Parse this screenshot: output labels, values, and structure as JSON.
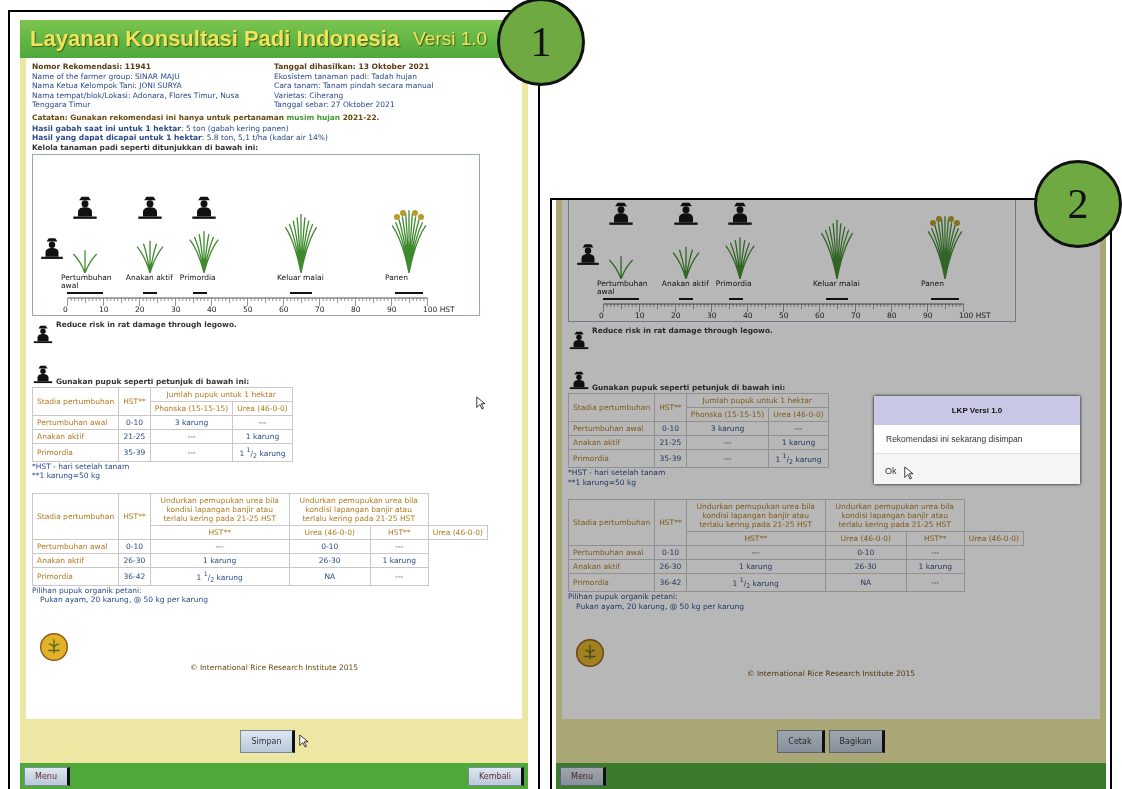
{
  "panels": [
    {
      "badge": "1",
      "header": {
        "title": "Layanan Konsultasi Padi Indonesia",
        "version": "Versi 1.0"
      },
      "info": {
        "left": [
          {
            "kind": "heading",
            "text": "Nomor Rekomendasi: 11941"
          },
          {
            "kind": "line",
            "text": "Name of the farmer group: SINAR MAJU"
          },
          {
            "kind": "line",
            "text": "Nama Ketua Kelompok Tani: JONI SURYA"
          },
          {
            "kind": "small",
            "text": "Nama tempat/blok/Lokasi: Adonara, Flores Timur, Nusa Tenggara Timur"
          }
        ],
        "right": [
          {
            "kind": "heading",
            "text": "Tanggal dihasilkan: 13 Oktober 2021"
          },
          {
            "kind": "line",
            "text": "Ekosistem tanaman padi: Tadah hujan"
          },
          {
            "kind": "line",
            "text": "Cara tanam: Tanam pindah secara manual"
          },
          {
            "kind": "small",
            "text": "Varietas: Ciherang"
          },
          {
            "kind": "line",
            "text": "Tanggal sebar: 27 Oktober 2021"
          }
        ]
      },
      "note": {
        "before": "Catatan: Gunakan rekomendasi ini hanya untuk pertanaman",
        "highlight": "musim hujan",
        "after": "2021-22."
      },
      "yields": [
        "**Hasil gabah saat ini untuk 1 hektar**: 5 ton (gabah kering panen)",
        "**Hasil yang dapat dicapai untuk 1 hektar**: 5.8 ton, 5,1 t/ha (kadar air 14%)"
      ],
      "manage_title": "Kelola tanaman padi seperti ditunjukkan di bawah ini:",
      "timeline": {
        "stages": [
          "Pertumbuhan awal",
          "Anakan aktif",
          "Primordia",
          "Keluar malai",
          "Panen"
        ],
        "axis": [
          "0",
          "10",
          "20",
          "30",
          "40",
          "50",
          "60",
          "70",
          "80",
          "90",
          "100 HST"
        ]
      },
      "rat_note": "Reduce risk in rat damage through legowo.",
      "fert_note": "Gunakan pupuk seperti petunjuk di bawah ini:",
      "table1": {
        "columns": [
          "Stadia pertumbuhan",
          "HST**"
        ],
        "group": "Jumlah pupuk untuk 1 hektar",
        "subheaders": [
          "Phonska (15-15-15)",
          "Urea (46-0-0)"
        ],
        "rows": [
          [
            "Pertumbuhan awal",
            "0-10",
            "3 karung",
            "---"
          ],
          [
            "Anakan aktif",
            "21-25",
            "---",
            "1 karung"
          ],
          [
            "Primordia",
            "35-39",
            "---",
            "1 $^{1}$/$_{2}$ karung"
          ]
        ]
      },
      "footnotes": [
        "*HST - hari setelah tanam",
        "**1 karung=50 kg"
      ],
      "table2": {
        "columns": [
          "Stadia pertumbuhan",
          "HST**"
        ],
        "groups": [
          "Undurkan pemupukan urea bila kondisi lapangan banjir atau terlalu kering pada 21-25 HST",
          "Undurkan pemupukan urea bila kondisi lapangan banjir atau terlalu kering pada 21-25 HST"
        ],
        "subheaders": [
          "HST**",
          "Urea (46-0-0)",
          "HST**",
          "Urea (46-0-0)"
        ],
        "rows": [
          [
            "Pertumbuhan awal",
            "0-10",
            "---",
            "0-10",
            "---"
          ],
          [
            "Anakan aktif",
            "26-30",
            "1 karung",
            "26-30",
            "1 karung"
          ],
          [
            "Primordia",
            "36-42",
            "1 $^{1}$/$_{2}$ karung",
            "NA",
            "---"
          ]
        ]
      },
      "organic": {
        "title": "Pilihan pupuk organik petani:",
        "text": "Pukan ayam, 20 karung, @ 50 kg per karung"
      },
      "copyright": "© International Rice Research Institute 2015",
      "actions": [
        "Simpan"
      ],
      "footer": {
        "left": "Menu",
        "right": "Kembali"
      }
    },
    {
      "badge": "2",
      "timeline": {
        "stages": [
          "Pertumbuhan awal",
          "Anakan aktif",
          "Primordia",
          "Keluar malai",
          "Panen"
        ],
        "axis": [
          "0",
          "10",
          "20",
          "30",
          "40",
          "50",
          "60",
          "70",
          "80",
          "90",
          "100 HST"
        ]
      },
      "rat_note": "Reduce risk in rat damage through legowo.",
      "fert_note": "Gunakan pupuk seperti petunjuk di bawah ini:",
      "table1": {
        "columns": [
          "Stadia pertumbuhan",
          "HST**"
        ],
        "group": "Jumlah pupuk untuk 1 hektar",
        "subheaders": [
          "Phonska (15-15-15)",
          "Urea (46-0-0)"
        ],
        "rows": [
          [
            "Pertumbuhan awal",
            "0-10",
            "3 karung",
            "---"
          ],
          [
            "Anakan aktif",
            "21-25",
            "---",
            "1 karung"
          ],
          [
            "Primordia",
            "35-39",
            "---",
            "1 $^{1}$/$_{2}$ karung"
          ]
        ]
      },
      "footnotes": [
        "*HST - hari setelah tanam",
        "**1 karung=50 kg"
      ],
      "table2": {
        "columns": [
          "Stadia pertumbuhan",
          "HST**"
        ],
        "groups": [
          "Undurkan pemupukan urea bila kondisi lapangan banjir atau terlalu kering pada 21-25 HST",
          "Undurkan pemupukan urea bila kondisi lapangan banjir atau terlalu kering pada 21-25 HST"
        ],
        "subheaders": [
          "HST**",
          "Urea (46-0-0)",
          "HST**",
          "Urea (46-0-0)"
        ],
        "rows": [
          [
            "Pertumbuhan awal",
            "0-10",
            "---",
            "0-10",
            "---"
          ],
          [
            "Anakan aktif",
            "26-30",
            "1 karung",
            "26-30",
            "1 karung"
          ],
          [
            "Primordia",
            "36-42",
            "1 $^{1}$/$_{2}$ karung",
            "NA",
            "---"
          ]
        ]
      },
      "organic": {
        "title": "Pilihan pupuk organik petani:",
        "text": "Pukan ayam, 20 karung, @ 50 kg per karung"
      },
      "copyright": "© International Rice Research Institute 2015",
      "actions": [
        "Cetak",
        "Bagikan"
      ],
      "footer": {
        "left": "Menu"
      },
      "dialog": {
        "title": "LKP Versi 1.0",
        "message": "Rekomendasi ini sekarang disimpan",
        "button": "Ok"
      }
    }
  ]
}
